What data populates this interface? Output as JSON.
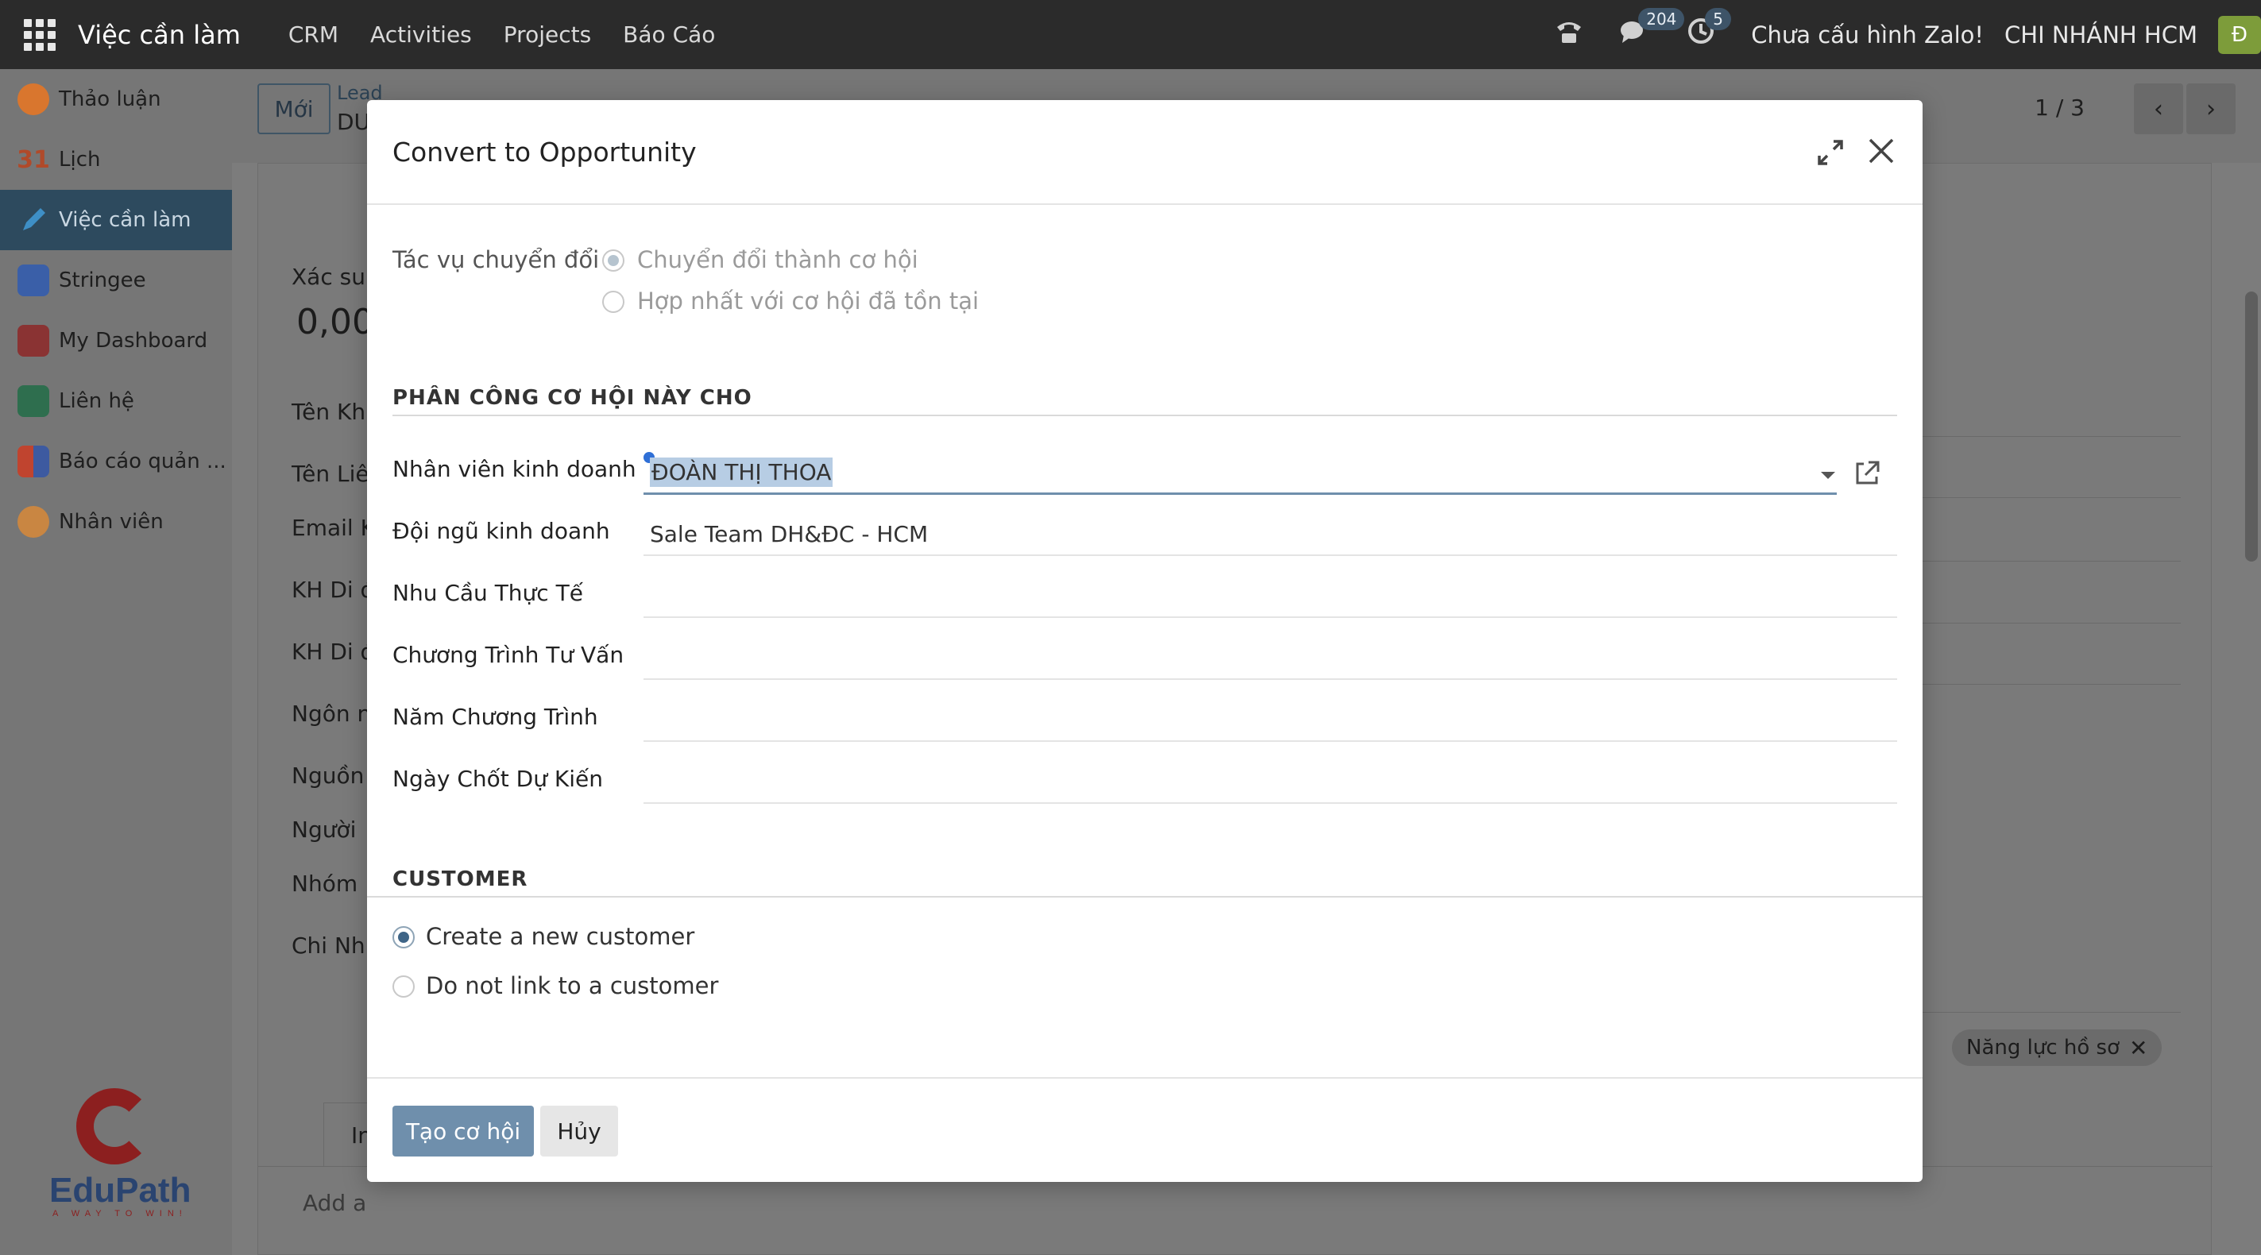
{
  "navbar": {
    "brand": "Việc cần làm",
    "menu": [
      "CRM",
      "Activities",
      "Projects",
      "Báo Cáo"
    ],
    "messages_count": "204",
    "activities_count": "5",
    "zalo_status": "Chưa cấu hình Zalo!",
    "company": "CHI NHÁNH HCM",
    "avatar_letter": "Đ"
  },
  "sidebar": {
    "items": [
      {
        "label": "Thảo luận",
        "icon": "discuss-icon",
        "color": "#e07b2e"
      },
      {
        "label": "Lịch",
        "icon": "calendar-icon",
        "color": "#3d6fb6"
      },
      {
        "label": "Việc cần làm",
        "icon": "pencil-icon",
        "color": "#2e7fb8",
        "active": true
      },
      {
        "label": "Stringee",
        "icon": "stringee-icon",
        "color": "#3a5fa8"
      },
      {
        "label": "My Dashboard",
        "icon": "dashboard-icon",
        "color": "#a03d3d"
      },
      {
        "label": "Liên hệ",
        "icon": "contact-icon",
        "color": "#2e8a5a"
      },
      {
        "label": "Báo cáo quản ...",
        "icon": "report-icon",
        "color": "#c0442f"
      },
      {
        "label": "Nhân viên",
        "icon": "employee-icon",
        "color": "#d0843a"
      }
    ],
    "logo_text": "EduPath",
    "logo_tagline": "A WAY TO WIN!"
  },
  "background": {
    "new_button": "Mới",
    "breadcrumb_parent": "Lead",
    "breadcrumb_current": "DU",
    "pager": "1 / 3",
    "labels": [
      "Xác su",
      "Tên Kh",
      "Tên Liê",
      "Email K",
      "KH Di đ",
      "KH Di đ",
      "Ngôn n",
      "Nguồn",
      "Người",
      "Nhóm",
      "Chi Nh"
    ],
    "probability_value": "0,00",
    "tag": "Năng lực hồ sơ",
    "tab": "Inter",
    "add_line": "Add a"
  },
  "modal": {
    "title": "Convert to Opportunity",
    "conversion_label": "Tác vụ chuyển đổi",
    "conversion_options": [
      {
        "label": "Chuyển đổi thành cơ hội",
        "checked": true
      },
      {
        "label": "Hợp nhất với cơ hội đã tồn tại",
        "checked": false
      }
    ],
    "assign_section": "PHÂN CÔNG CƠ HỘI NÀY CHO",
    "fields": [
      {
        "label": "Nhân viên kinh doanh",
        "value": "ĐOÀN THỊ THOA"
      },
      {
        "label": "Đội ngũ kinh doanh",
        "value": "Sale Team DH&ĐC - HCM"
      },
      {
        "label": "Nhu Cầu Thực Tế",
        "value": ""
      },
      {
        "label": "Chương Trình Tư Vấn",
        "value": ""
      },
      {
        "label": "Năm Chương Trình",
        "value": ""
      },
      {
        "label": "Ngày Chốt Dự Kiến",
        "value": ""
      }
    ],
    "customer_section": "CUSTOMER",
    "customer_options": [
      {
        "label": "Create a new customer",
        "checked": true
      },
      {
        "label": "Do not link to a customer",
        "checked": false
      }
    ],
    "submit_label": "Tạo cơ hội",
    "cancel_label": "Hủy"
  }
}
